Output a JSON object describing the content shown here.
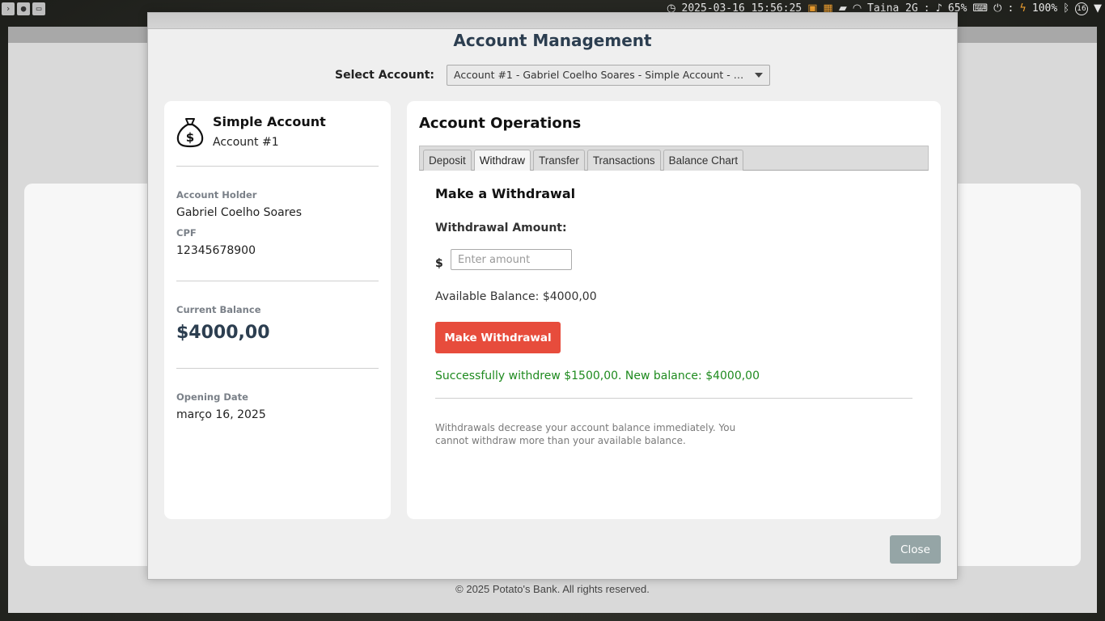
{
  "system_bar": {
    "datetime": "2025-03-16 15:56:25",
    "wifi_name": "Taina_2G",
    "volume": "65%",
    "battery": "100%",
    "notification_count": "16",
    "icons": [
      "clock-icon",
      "terminal-icon",
      "calendar-icon",
      "folder-icon",
      "wifi-icon",
      "volume-icon",
      "keyboard-icon",
      "power-icon",
      "battery-charging-icon",
      "bluetooth-icon"
    ]
  },
  "background_app": {
    "footer": "© 2025 Potato's Bank. All rights reserved."
  },
  "modal": {
    "title": "Account Management",
    "select_label": "Select Account:",
    "selected_account": "Account #1 - Gabriel Coelho Soares - Simple Account - B...",
    "close_label": "Close"
  },
  "account_card": {
    "icon": "money-bag-icon",
    "type": "Simple Account",
    "number": "Account #1",
    "holder_label": "Account Holder",
    "holder": "Gabriel Coelho Soares",
    "cpf_label": "CPF",
    "cpf": "12345678900",
    "balance_label": "Current Balance",
    "balance": "$4000,00",
    "opening_label": "Opening Date",
    "opening_date": "março 16, 2025"
  },
  "operations": {
    "title": "Account Operations",
    "tabs": [
      {
        "label": "Deposit",
        "active": false
      },
      {
        "label": "Withdraw",
        "active": true
      },
      {
        "label": "Transfer",
        "active": false
      },
      {
        "label": "Transactions",
        "active": false
      },
      {
        "label": "Balance Chart",
        "active": false
      }
    ],
    "withdraw": {
      "heading": "Make a Withdrawal",
      "amount_label": "Withdrawal Amount:",
      "currency": "$",
      "amount_value": "",
      "amount_placeholder": "Enter amount",
      "available_balance": "Available Balance: $4000,00",
      "button_label": "Make Withdrawal",
      "success_message": "Successfully withdrew $1500,00. New balance: $4000,00",
      "note": "Withdrawals decrease your account balance immediately. You cannot withdraw more than your available balance."
    }
  },
  "colors": {
    "withdraw_button": "#e74c3c",
    "close_button": "#95a5a6",
    "success_text": "#1e8a1e",
    "heading_text": "#2c3e50"
  }
}
